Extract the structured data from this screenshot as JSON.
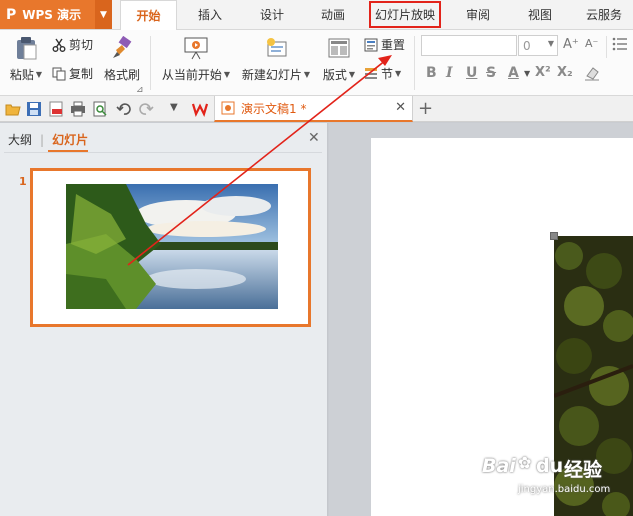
{
  "app": {
    "name": "WPS 演示",
    "logo_glyph": "P",
    "accent": "#e8772c",
    "highlight_color": "#e2231a"
  },
  "menu_tabs": [
    {
      "label": "开始",
      "active": true
    },
    {
      "label": "插入"
    },
    {
      "label": "设计"
    },
    {
      "label": "动画"
    },
    {
      "label": "幻灯片放映",
      "highlighted": true
    },
    {
      "label": "审阅"
    },
    {
      "label": "视图"
    },
    {
      "label": "云服务"
    }
  ],
  "ribbon": {
    "paste": "粘贴",
    "cut": "剪切",
    "copy": "复制",
    "format_painter": "格式刷",
    "from_current": "从当前开始",
    "new_slide": "新建幻灯片",
    "layout": "版式",
    "reset": "重置",
    "section": "节",
    "font_name": "",
    "font_size": "0",
    "format_buttons": [
      "B",
      "I",
      "U",
      "S",
      "A",
      "X²",
      "X₂"
    ]
  },
  "document": {
    "tab_title": "演示文稿1 *"
  },
  "left_pane": {
    "tab_outline": "大纲",
    "tab_slides": "幻灯片",
    "slide_number": "1"
  },
  "watermark": {
    "brand": "Bai",
    "brand2": "du",
    "product": "经验",
    "url": "jingyan.baidu.com"
  }
}
